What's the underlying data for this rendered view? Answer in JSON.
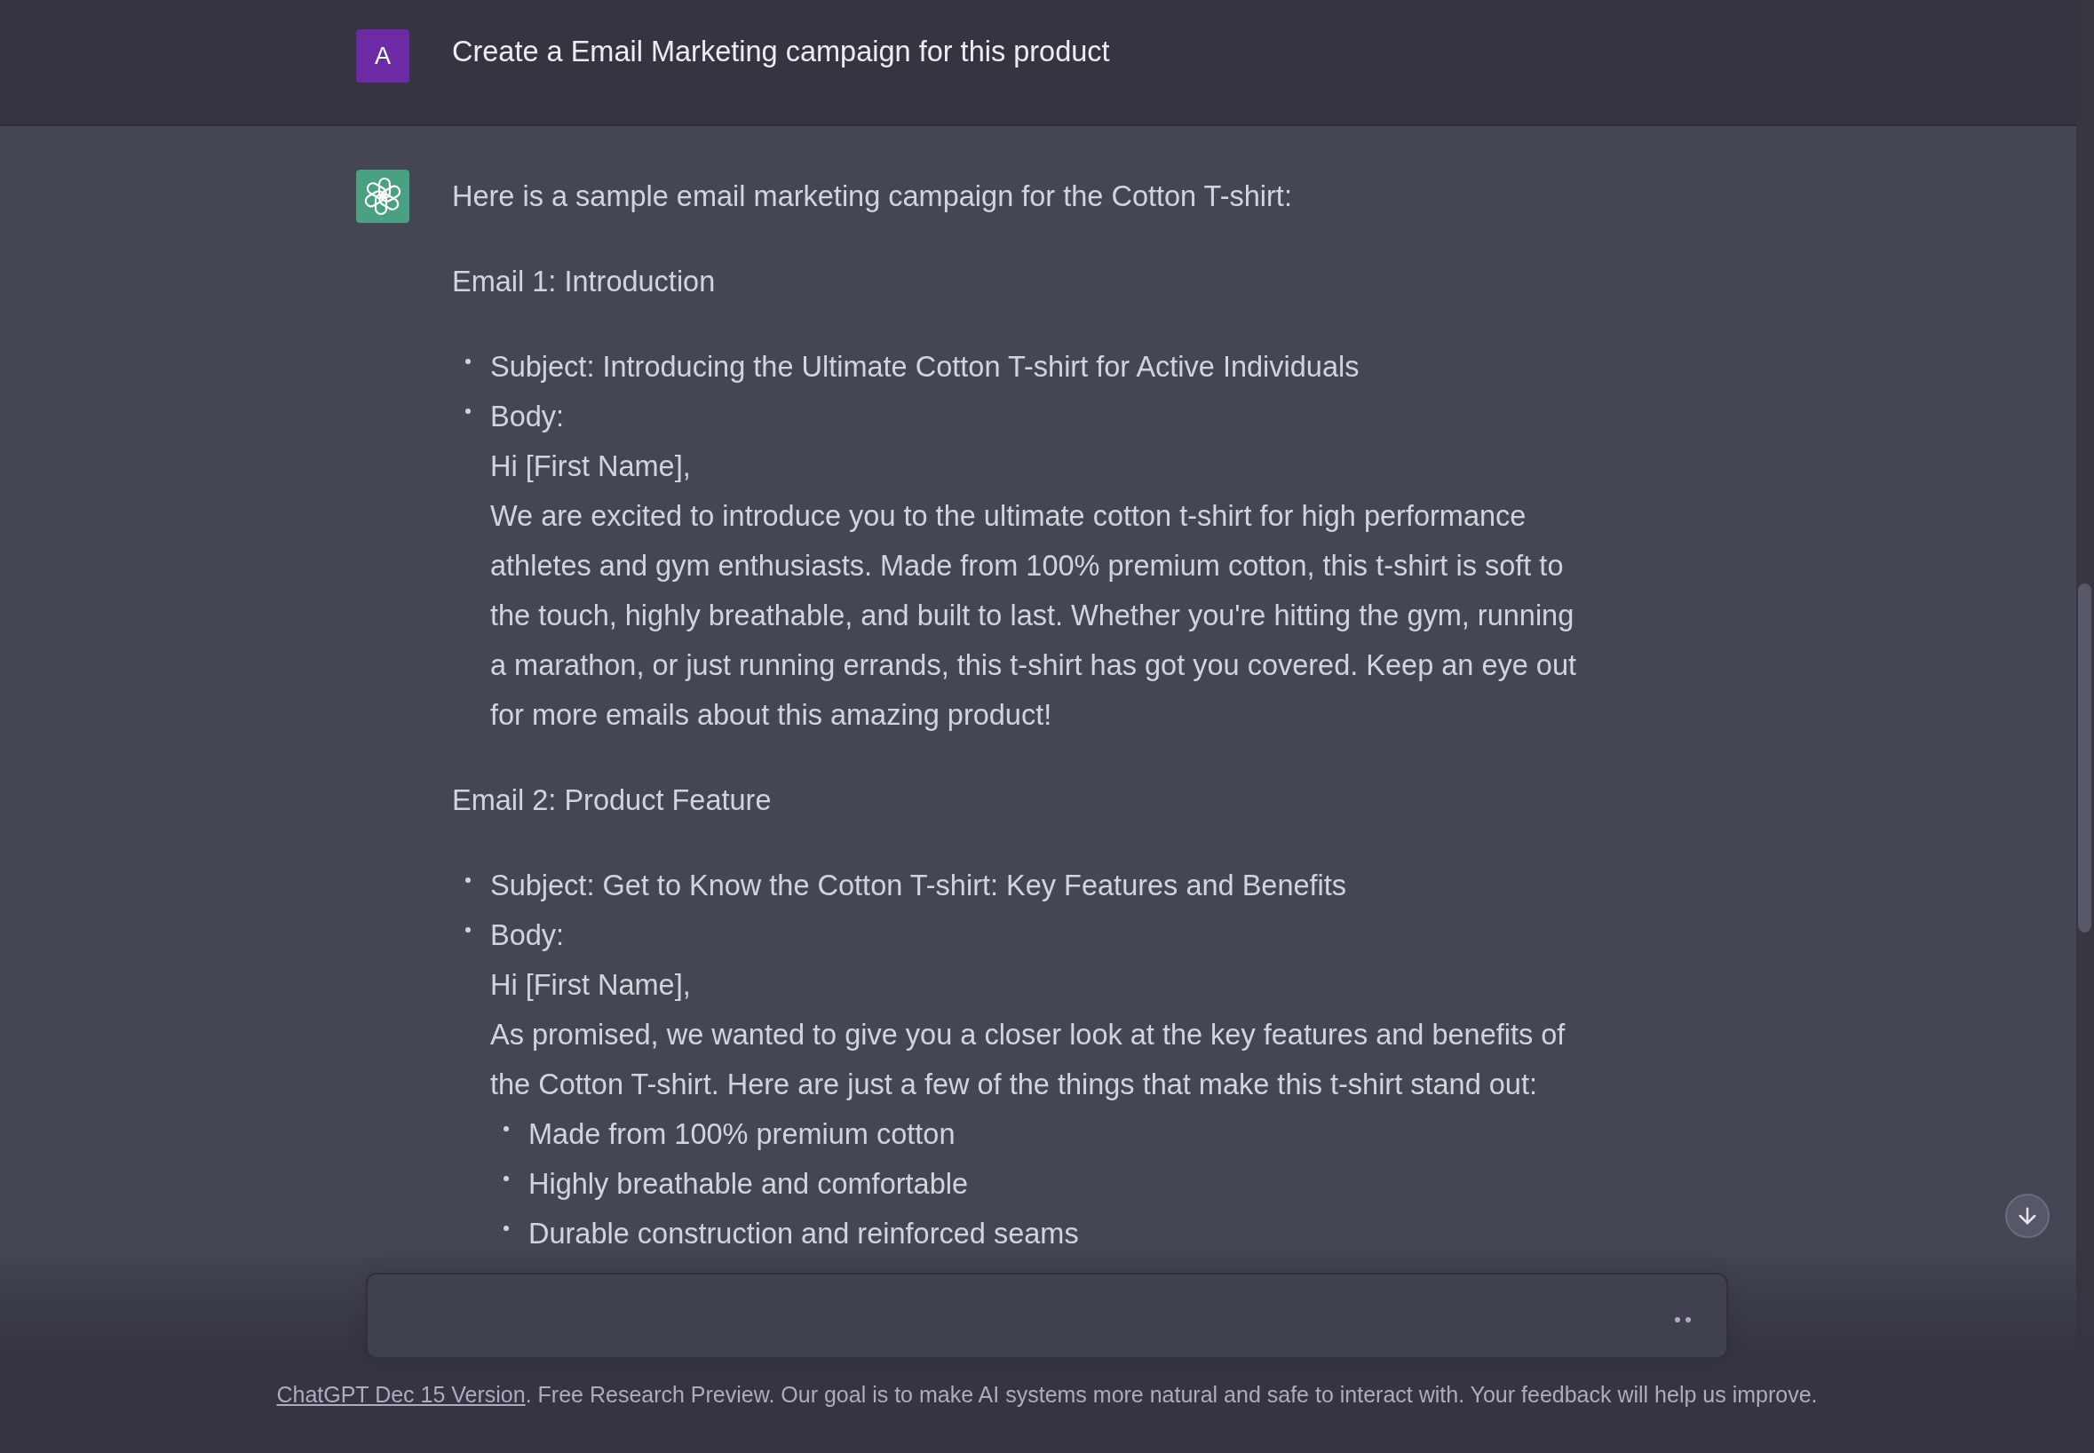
{
  "user_message": {
    "avatar_letter": "A",
    "text": "Create a Email Marketing campaign for this product"
  },
  "assistant_message": {
    "intro": "Here is a sample email marketing campaign for the Cotton T-shirt:",
    "emails": [
      {
        "heading": "Email 1: Introduction",
        "subject": "Subject: Introducing the Ultimate Cotton T-shirt for Active Individuals",
        "body_label": "Body:",
        "greeting": "Hi [First Name],",
        "text": "We are excited to introduce you to the ultimate cotton t-shirt for high performance athletes and gym enthusiasts. Made from 100% premium cotton, this t-shirt is soft to the touch, highly breathable, and built to last. Whether you're hitting the gym, running a marathon, or just running errands, this t-shirt has got you covered. Keep an eye out for more emails about this amazing product!"
      },
      {
        "heading": "Email 2: Product Feature",
        "subject": "Subject: Get to Know the Cotton T-shirt: Key Features and Benefits",
        "body_label": "Body:",
        "greeting": "Hi [First Name],",
        "text": "As promised, we wanted to give you a closer look at the key features and benefits of the Cotton T-shirt. Here are just a few of the things that make this t-shirt stand out:",
        "points": [
          "Made from 100% premium cotton",
          "Highly breathable and comfortable",
          "Durable construction and reinforced seams"
        ]
      }
    ]
  },
  "composer": {
    "loading": true
  },
  "footer": {
    "link": "ChatGPT Dec 15 Version",
    "text": ". Free Research Preview. Our goal is to make AI systems more natural and safe to interact with. Your feedback will help us improve."
  }
}
